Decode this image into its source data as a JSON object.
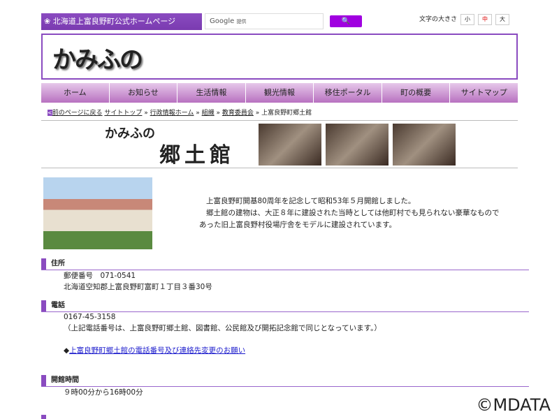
{
  "header": {
    "site_title": "北海道上富良野町公式ホームページ",
    "search_brand": "Google",
    "search_sub": "提供",
    "search_button": "🔍",
    "font_size_label": "文字の大きさ",
    "font_sizes": [
      "小",
      "中",
      "大"
    ],
    "logo_text": "かみふの"
  },
  "nav": [
    "ホーム",
    "お知らせ",
    "生活情報",
    "観光情報",
    "移住ポータル",
    "町の概要",
    "サイトマップ"
  ],
  "breadcrumb": {
    "back": "前のページに戻る",
    "items": [
      "サイトトップ",
      "行政情報ホーム",
      "組織",
      "教育委員会"
    ],
    "current": "上富良野町郷土館"
  },
  "banner": {
    "small": "かみふの",
    "large": "郷土館"
  },
  "intro": [
    "上富良野町開基80周年を記念して昭和53年５月開館しました。",
    "郷土館の建物は、大正８年に建設された当時としては他町村でも見られない豪華なもので",
    "あった旧上富良野村役場庁舎をモデルに建設されています。"
  ],
  "sections": {
    "address": {
      "title": "住所",
      "postal": "郵便番号　071-0541",
      "address": "北海道空知郡上富良野町富町１丁目３番30号"
    },
    "phone": {
      "title": "電話",
      "number": "0167-45-3158",
      "note": "（上記電話番号は、上富良野町郷土館、図書館、公民館及び開拓記念館で同じとなっています。）",
      "link": "上富良野町郷土館の電話番号及び連絡先変更のお願い"
    },
    "hours": {
      "title": "開館時間",
      "value": "９時00分から16時00分"
    }
  },
  "watermark": "©MDATA"
}
